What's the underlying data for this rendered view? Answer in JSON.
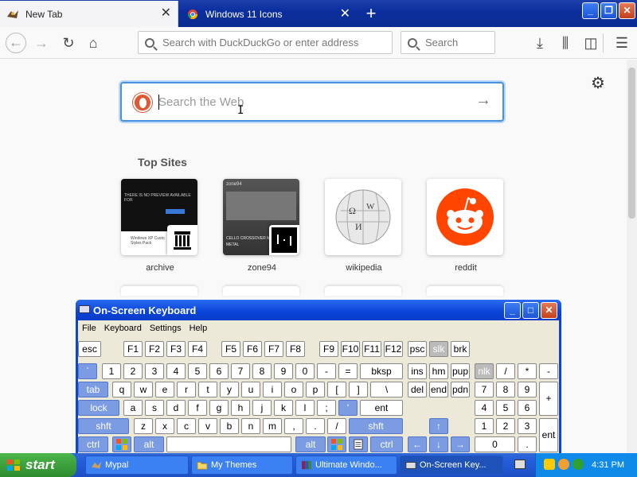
{
  "browser": {
    "tabs": [
      {
        "label": "New Tab",
        "active": true
      },
      {
        "label": "Windows 11 Icons",
        "active": false
      }
    ],
    "address_placeholder": "Search with DuckDuckGo or enter address",
    "search_placeholder": "Search"
  },
  "newtab": {
    "search_placeholder": "Search the Web",
    "top_sites_title": "Top Sites",
    "top_sites": [
      {
        "label": "archive"
      },
      {
        "label": "zone94"
      },
      {
        "label": "wikipedia"
      },
      {
        "label": "reddit"
      }
    ],
    "archive_thumb_lines": [
      "THERE IS NO PREVIEW AVAILABLE FOR",
      "Windows XP Custo",
      "Styles Pack"
    ],
    "zone94_thumb_lines": [
      "zone94",
      "CELLO CROSSOVER MIN",
      "METAL"
    ]
  },
  "osk": {
    "title": "On-Screen Keyboard",
    "menu": [
      "File",
      "Keyboard",
      "Settings",
      "Help"
    ],
    "keys": {
      "esc": "esc",
      "f1": "F1",
      "f2": "F2",
      "f3": "F3",
      "f4": "F4",
      "f5": "F5",
      "f6": "F6",
      "f7": "F7",
      "f8": "F8",
      "f9": "F9",
      "f10": "F10",
      "f11": "F11",
      "f12": "F12",
      "psc": "psc",
      "slk": "slk",
      "brk": "brk",
      "backtick": "`",
      "d1": "1",
      "d2": "2",
      "d3": "3",
      "d4": "4",
      "d5": "5",
      "d6": "6",
      "d7": "7",
      "d8": "8",
      "d9": "9",
      "d0": "0",
      "minus": "-",
      "equals": "=",
      "bksp": "bksp",
      "ins": "ins",
      "hm": "hm",
      "pup": "pup",
      "nlk": "nlk",
      "slash": "/",
      "star": "*",
      "nminus": "-",
      "tab": "tab",
      "q": "q",
      "w": "w",
      "e": "e",
      "r": "r",
      "t": "t",
      "y": "y",
      "u": "u",
      "i": "i",
      "o": "o",
      "p": "p",
      "lbr": "[",
      "rbr": "]",
      "bslash": "\\",
      "del": "del",
      "end": "end",
      "pdn": "pdn",
      "n7": "7",
      "n8": "8",
      "n9": "9",
      "nplus": "+",
      "lock": "lock",
      "a": "a",
      "s": "s",
      "d": "d",
      "f": "f",
      "g": "g",
      "h": "h",
      "j": "j",
      "k": "k",
      "l": "l",
      "semi": ";",
      "quote": "'",
      "ent": "ent",
      "n4": "4",
      "n5": "5",
      "n6": "6",
      "lshft": "shft",
      "z": "z",
      "x": "x",
      "c": "c",
      "v": "v",
      "b": "b",
      "n": "n",
      "m": "m",
      "comma": ",",
      "period": ".",
      "fslash": "/",
      "rshft": "shft",
      "up": "↑",
      "n1": "1",
      "n2": "2",
      "n3": "3",
      "nent": "ent",
      "lctrl": "ctrl",
      "lalt": "alt",
      "ralt": "alt",
      "rctrl": "ctrl",
      "left": "←",
      "down": "↓",
      "right": "→",
      "n0": "0",
      "ndot": "."
    }
  },
  "taskbar": {
    "start_label": "start",
    "tasks": [
      {
        "label": "Mypal"
      },
      {
        "label": "My Themes"
      },
      {
        "label": "Ultimate Windo..."
      },
      {
        "label": "On-Screen Key..."
      }
    ],
    "clock": "4:31 PM"
  },
  "colors": {
    "xp_blue": "#0a44d8",
    "start_green": "#3c9a3c",
    "focus_blue": "#4a90e2",
    "reddit_orange": "#ff4500",
    "ddg_orange": "#de5833"
  },
  "icons": [
    "duckduckgo-icon",
    "back-icon",
    "forward-icon",
    "reload-icon",
    "home-icon",
    "download-icon",
    "library-icon",
    "sidebar-icon",
    "menu-icon",
    "gear-icon",
    "arrow-right-icon",
    "windows-logo-icon"
  ]
}
